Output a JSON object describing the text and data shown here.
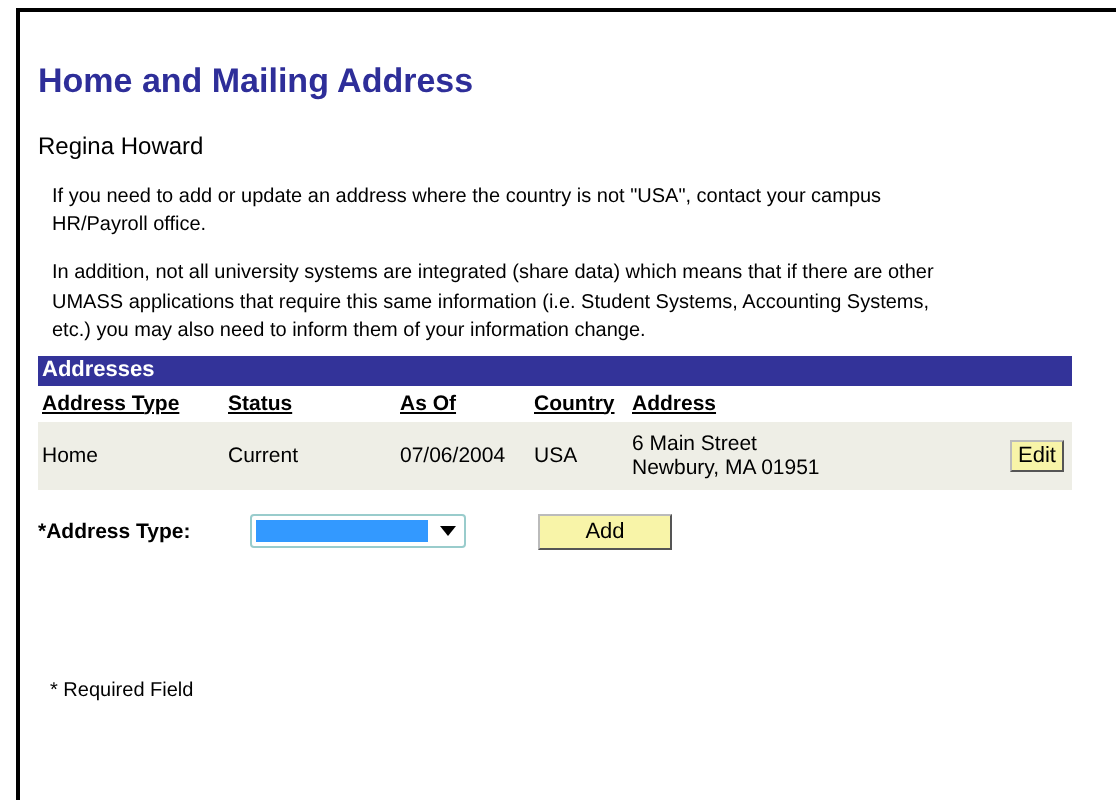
{
  "page": {
    "title": "Home and Mailing Address",
    "person": "Regina Howard",
    "notes": [
      "If you need to add or update an address where the country is not \"USA\", contact your campus HR/Payroll office.",
      "In addition, not all university systems are integrated (share data) which means that if there are other UMASS applications that require this same information (i.e. Student Systems, Accounting Systems, etc.) you may also need to inform them of your information change."
    ]
  },
  "addresses": {
    "title": "Addresses",
    "columns": [
      "Address Type",
      "Status",
      "As Of",
      "Country",
      "Address"
    ],
    "rows": [
      {
        "cells": [
          "Home",
          "Current",
          "07/06/2004",
          "USA"
        ],
        "address": [
          "6 Main Street",
          "Newbury, MA 01951"
        ],
        "button": "Edit"
      }
    ]
  },
  "address_type": {
    "label": "*Address Type:",
    "focused": true,
    "button": "Add"
  },
  "footer": "* Required Field"
}
